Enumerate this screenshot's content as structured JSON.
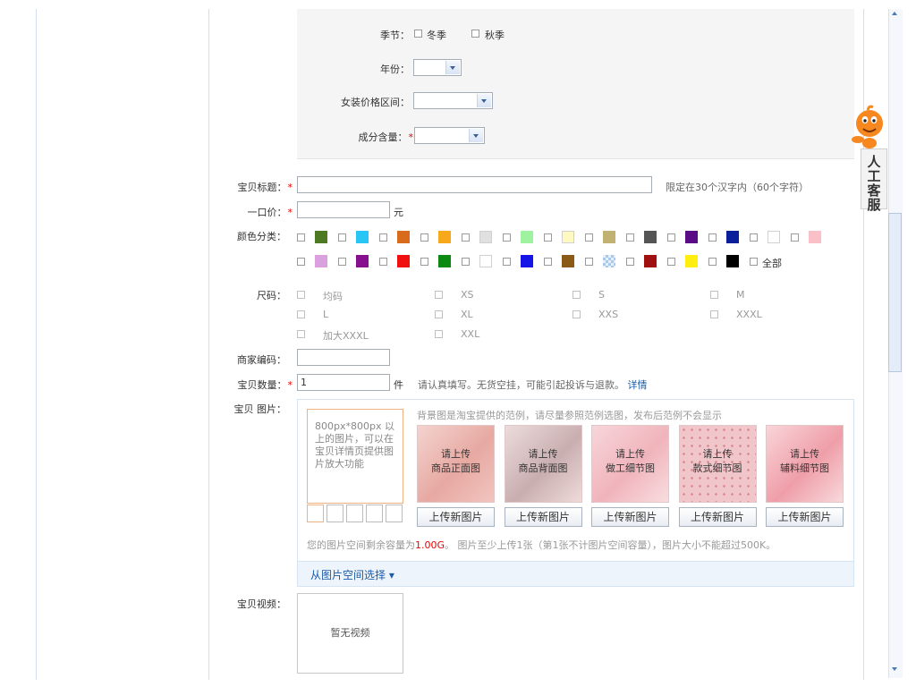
{
  "attributes": {
    "season": {
      "label": "季节：",
      "options": [
        "冬季",
        "秋季"
      ]
    },
    "year": {
      "label": "年份："
    },
    "price_range": {
      "label": "女装价格区间："
    },
    "composition": {
      "label": "成分含量：",
      "required": "*"
    }
  },
  "form": {
    "title": {
      "label": "宝贝标题：",
      "required": "*",
      "hint": "限定在30个汉字内（60个字符）"
    },
    "price": {
      "label": "一口价：",
      "required": "*",
      "unit": "元"
    },
    "color": {
      "label": "颜色分类：",
      "row1": [
        "#4e7a23",
        "#27c6f5",
        "#d96b1d",
        "#f7a81b",
        "#e0e0e0",
        "#9ff29f",
        "#fff8c0",
        "#c1b273",
        "#555555",
        "#5a0c86",
        "#0b1f9a",
        "#ffffff",
        "#f9c0c8"
      ],
      "row2": [
        "#dba0de",
        "#86108d",
        "#f01010",
        "#0a8a12",
        "#ffffff",
        "#1515e8",
        "#8b5a14",
        "pattern",
        "#a01010",
        "#ffee10",
        "#000000"
      ],
      "all_label": "全部"
    },
    "size": {
      "label": "尺码：",
      "items": [
        "均码",
        "XS",
        "S",
        "M",
        "L",
        "XL",
        "XXS",
        "XXXL",
        "加大XXXL",
        "XXL"
      ]
    },
    "sku_code": {
      "label": "商家编码："
    },
    "quantity": {
      "label": "宝贝数量：",
      "required": "*",
      "value": "1",
      "unit": "件",
      "hint": "请认真填写。无货空挂，可能引起投诉与退款。",
      "link": "详情"
    },
    "images": {
      "label": "宝贝 图片：",
      "bg_hint": "背景图是淘宝提供的范例，请尽量参照范例选图，发布后范例不会显示",
      "main_hint": "800px*800px 以上的图片，可以在宝贝详情页提供图片放大功能",
      "slots": [
        {
          "line1": "请上传",
          "line2": "商品正面图"
        },
        {
          "line1": "请上传",
          "line2": "商品背面图"
        },
        {
          "line1": "请上传",
          "line2": "做工细节图"
        },
        {
          "line1": "请上传",
          "line2": "款式细节图"
        },
        {
          "line1": "请上传",
          "line2": "辅料细节图"
        }
      ],
      "upload_label": "上传新图片",
      "capacity_prefix": "您的图片空间剩余容量为",
      "capacity_value": "1.00G",
      "capacity_suffix": "。 图片至少上传1张（第1张不计图片空间容量），图片大小不能超过500K。",
      "select_from_space": "从图片空间选择 ▾"
    },
    "video": {
      "label": "宝贝视频：",
      "empty": "暂无视频"
    }
  },
  "customer_service": {
    "label": "人工客服"
  }
}
